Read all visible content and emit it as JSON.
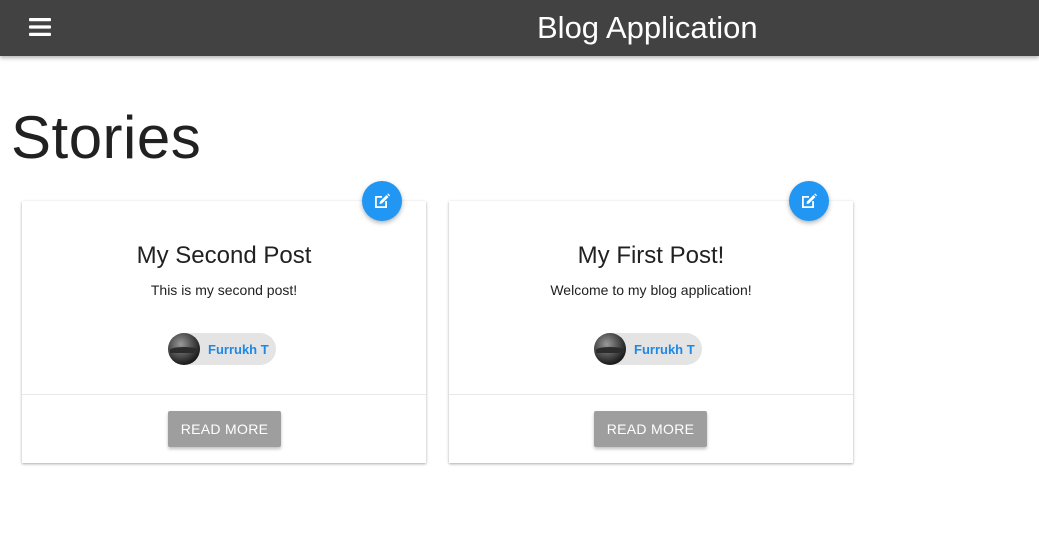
{
  "header": {
    "title": "Blog Application",
    "menu_icon": "hamburger-menu-icon",
    "background": "#424242"
  },
  "page": {
    "heading": "Stories"
  },
  "posts": [
    {
      "title": "My Second Post",
      "body": "This is my second post!",
      "author": "Furrukh T",
      "action_label": "READ MORE",
      "edit_icon": "edit-icon"
    },
    {
      "title": "My First Post!",
      "body": "Welcome to my blog application!",
      "author": "Furrukh T",
      "action_label": "READ MORE",
      "edit_icon": "edit-icon"
    }
  ],
  "colors": {
    "accent": "#2196f3",
    "author_link": "#1e88e5",
    "button": "#9e9e9e",
    "chip": "#e4e4e4"
  }
}
